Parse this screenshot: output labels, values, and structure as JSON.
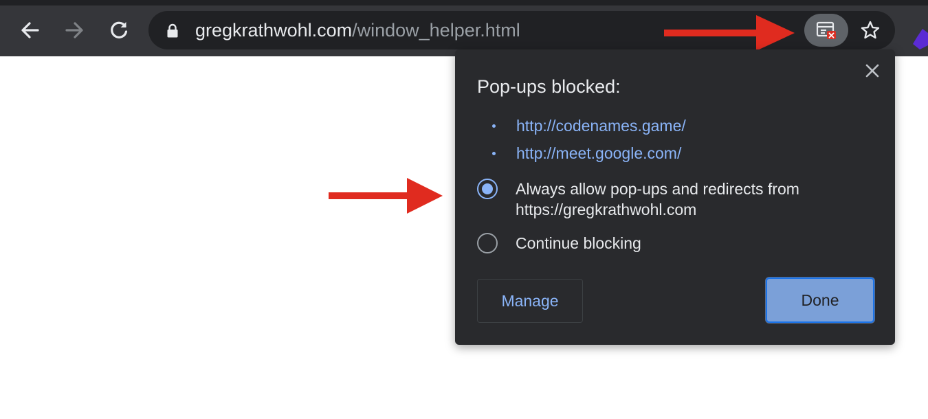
{
  "browser": {
    "url_host": "gregkrathwohl.com",
    "url_path": "/window_helper.html",
    "icons": {
      "back": "arrow-left-icon",
      "forward": "arrow-right-icon",
      "reload": "reload-icon",
      "lock": "lock-icon",
      "popup_blocked": "popup-blocked-icon",
      "bookmark": "star-icon"
    }
  },
  "dialog": {
    "title": "Pop-ups blocked:",
    "blocked_links": [
      "http://codenames.game/",
      "http://meet.google.com/"
    ],
    "options": [
      {
        "label": "Always allow pop-ups and redirects from https://gregkrathwohl.com",
        "checked": true
      },
      {
        "label": "Continue blocking",
        "checked": false
      }
    ],
    "manage_label": "Manage",
    "done_label": "Done"
  },
  "colors": {
    "toolbar": "#35363a",
    "dialog_bg": "#292a2d",
    "link": "#8ab4f8",
    "done_button": "#7ba0d8",
    "annotation_arrow": "#e02b1f"
  }
}
